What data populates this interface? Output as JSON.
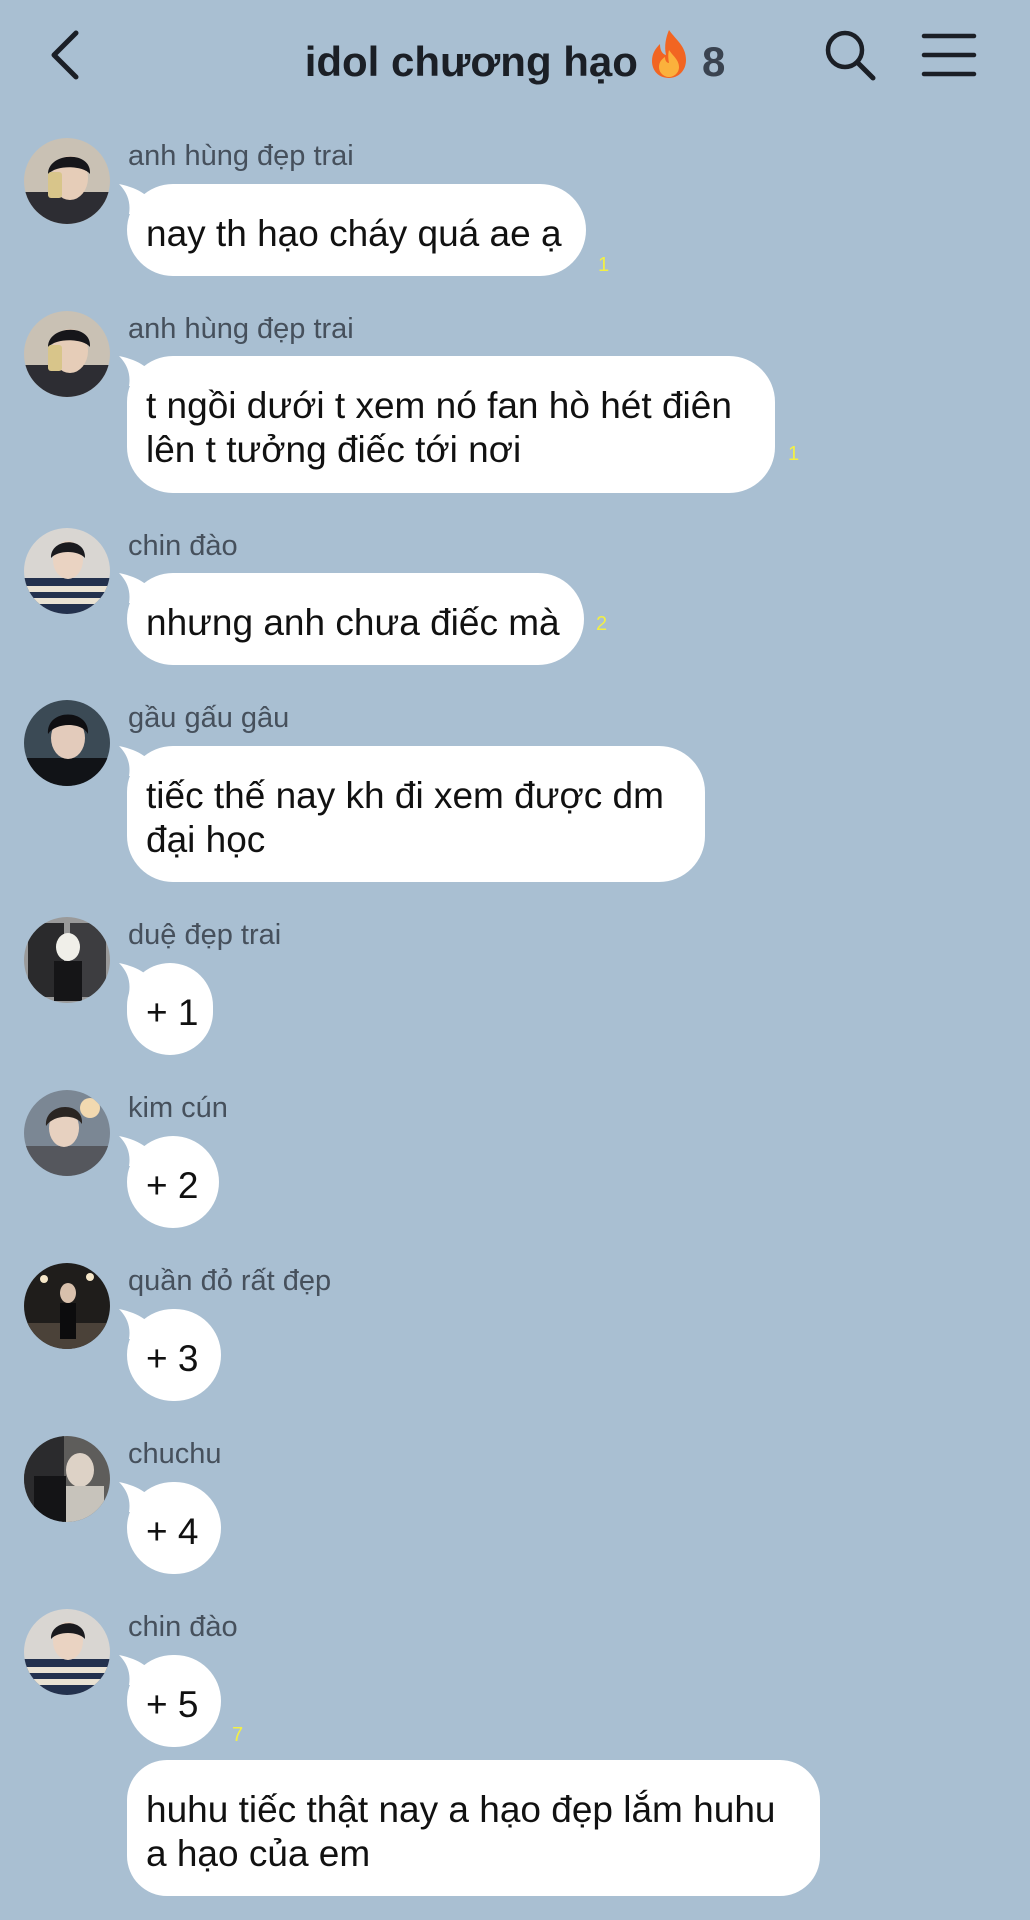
{
  "header": {
    "title": "idol chương hạo",
    "emoji": "🔥",
    "member_count": "8"
  },
  "messages": [
    {
      "sender": "anh hùng đẹp trai",
      "lines": [
        "nay th hạo cháy quá ae ạ"
      ],
      "read": "1"
    },
    {
      "sender": "anh hùng đẹp trai",
      "lines": [
        "t ngồi dưới t xem nó fan hò hét điên",
        "lên t tưởng điếc tới nơi"
      ],
      "read": "1"
    },
    {
      "sender": "chin đào",
      "lines": [
        "nhưng anh chưa điếc mà"
      ],
      "read": "2"
    },
    {
      "sender": "gầu gấu gâu",
      "lines": [
        "tiếc thế nay kh đi xem được dm",
        "đại học"
      ],
      "read": ""
    },
    {
      "sender": "duệ đẹp trai",
      "lines": [
        "+ 1"
      ],
      "read": ""
    },
    {
      "sender": "kim cún",
      "lines": [
        "+ 2"
      ],
      "read": ""
    },
    {
      "sender": "quần đỏ rất đẹp",
      "lines": [
        "+ 3"
      ],
      "read": ""
    },
    {
      "sender": "chuchu",
      "lines": [
        "+ 4"
      ],
      "read": ""
    },
    {
      "sender": "chin đào",
      "lines": [
        "+ 5"
      ],
      "read": "7"
    },
    {
      "sender": "",
      "lines": [
        "huhu tiếc thật nay a hạo đẹp lắm huhu",
        "a hạo của em"
      ],
      "read": ""
    }
  ],
  "colors": {
    "background": "#a9bfd2",
    "bubble": "#ffffff",
    "read_count": "#f2ef45"
  }
}
